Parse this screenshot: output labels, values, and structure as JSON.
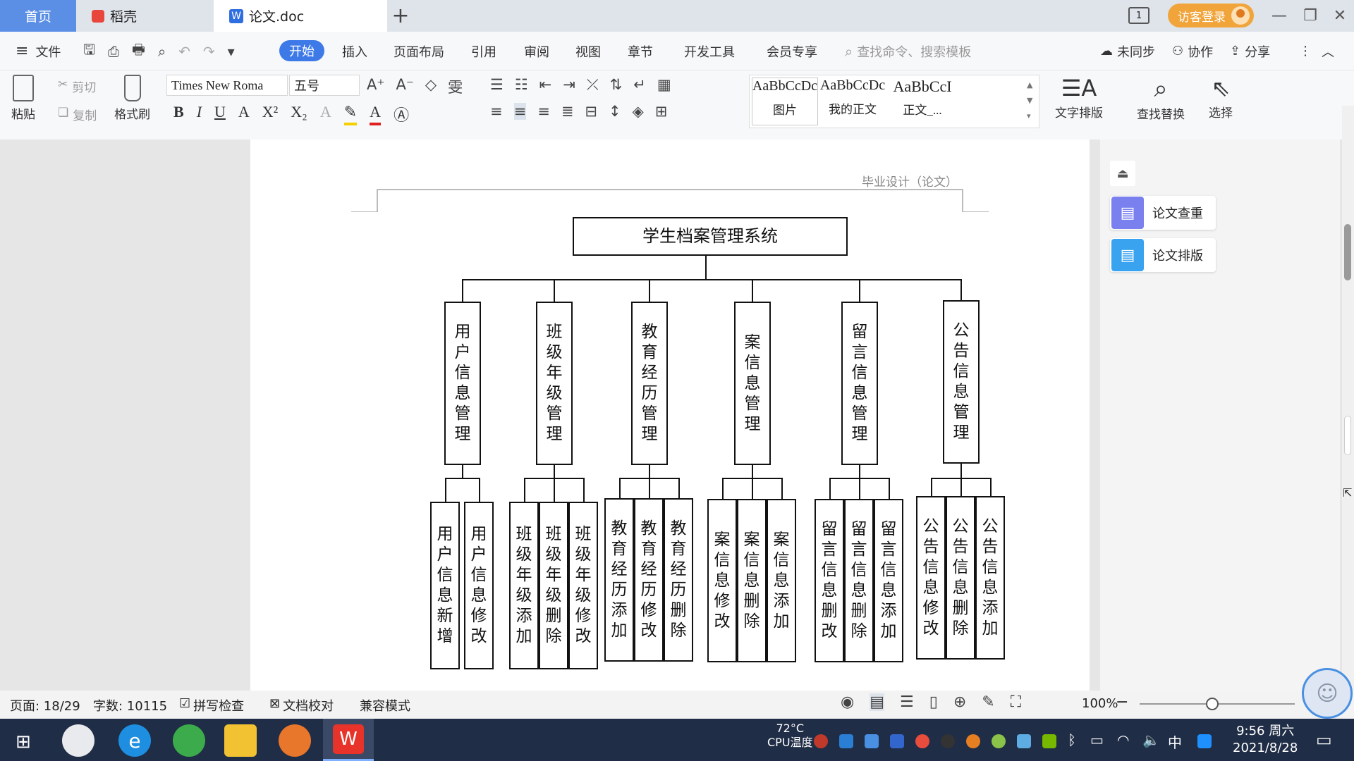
{
  "tabs": {
    "home": "首页",
    "daoke": "稻壳",
    "doc": "论文.doc",
    "add": "+"
  },
  "window": {
    "login": "访客登录",
    "page_indicator": "1"
  },
  "menu": {
    "file": "文件",
    "items": [
      "开始",
      "插入",
      "页面布局",
      "引用",
      "审阅",
      "视图",
      "章节",
      "开发工具",
      "会员专享"
    ],
    "search_placeholder": "查找命令、搜索模板",
    "sync": "未同步",
    "collab": "协作",
    "share": "分享"
  },
  "ribbon": {
    "paste": "粘贴",
    "cut": "剪切",
    "copy": "复制",
    "format_painter": "格式刷",
    "font_name": "Times New Roma",
    "font_size": "五号",
    "styles": [
      {
        "preview": "AaBbCcDc",
        "label": "图片"
      },
      {
        "preview": "AaBbCcDc",
        "label": "我的正文"
      },
      {
        "preview": "AaBbCcI",
        "label": "正文_..."
      }
    ],
    "text_layout": "文字排版",
    "find_replace": "查找替换",
    "select": "选择"
  },
  "document": {
    "header_text": "毕业设计（论文）",
    "root": "学生档案管理系统",
    "modules": [
      {
        "name": "用户信息管理",
        "children": [
          "用户信息新增",
          "用户信息修改"
        ]
      },
      {
        "name": "班级年级管理",
        "children": [
          "班级年级添加",
          "班级年级删除",
          "班级年级修改"
        ]
      },
      {
        "name": "教育经历管理",
        "children": [
          "教育经历添加",
          "教育经历修改",
          "教育经历删除"
        ]
      },
      {
        "name": "案信息管理",
        "children": [
          "案信息修改",
          "案信息删除",
          "案信息添加"
        ]
      },
      {
        "name": "留言信息管理",
        "children": [
          "留言信息删改",
          "留言信息删除",
          "留言信息添加"
        ]
      },
      {
        "name": "公告信息管理",
        "children": [
          "公告信息修改",
          "公告信息删除",
          "公告信息添加"
        ]
      }
    ]
  },
  "side_panel": {
    "check": "论文查重",
    "layout": "论文排版"
  },
  "status": {
    "page": "页面: 18/29",
    "words": "字数: 10115",
    "spell": "拼写检查",
    "proof": "文档校对",
    "compat": "兼容模式",
    "zoom": "100%"
  },
  "taskbar": {
    "temp": "72°C",
    "cpu": "CPU温度",
    "lang": "中",
    "time": "9:56 周六",
    "date": "2021/8/28"
  }
}
